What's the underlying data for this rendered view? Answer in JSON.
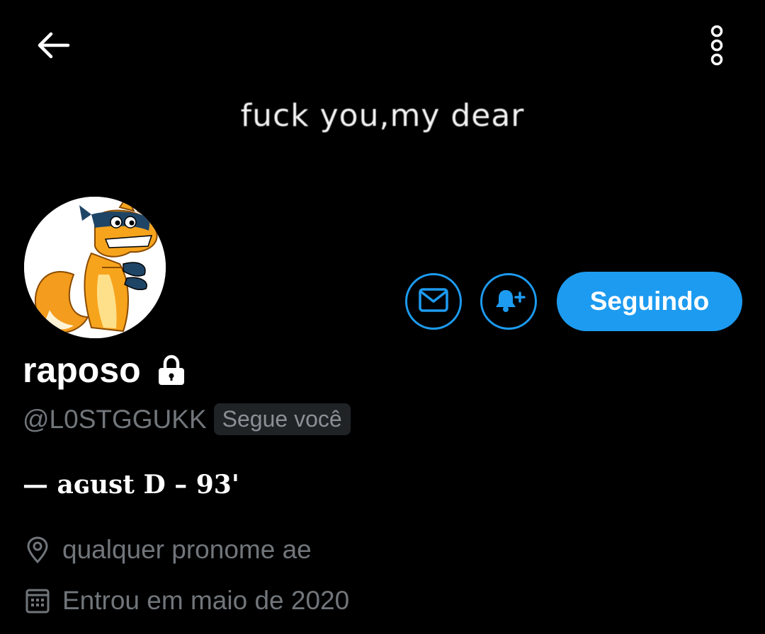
{
  "header": {
    "back_icon": "arrow-left-icon",
    "more_icon": "more-vertical-icon",
    "banner_text": "fuck you,my dear"
  },
  "profile": {
    "avatar_icon": "fox-cartoon-avatar",
    "display_name": "raposo",
    "protected_icon": "lock-icon",
    "handle": "@L0STGGUKK",
    "follows_you": "Segue você",
    "bio": "— aɢust D – 93'",
    "location_icon": "location-pin-icon",
    "location": "qualquer pronome ae",
    "joined_icon": "calendar-icon",
    "joined": "Entrou em maio de 2020"
  },
  "actions": {
    "message_icon": "envelope-icon",
    "notify_icon": "bell-plus-icon",
    "follow_label": "Seguindo"
  },
  "colors": {
    "background": "#000000",
    "accent": "#1d9bf0",
    "secondary_text": "#71767b"
  }
}
